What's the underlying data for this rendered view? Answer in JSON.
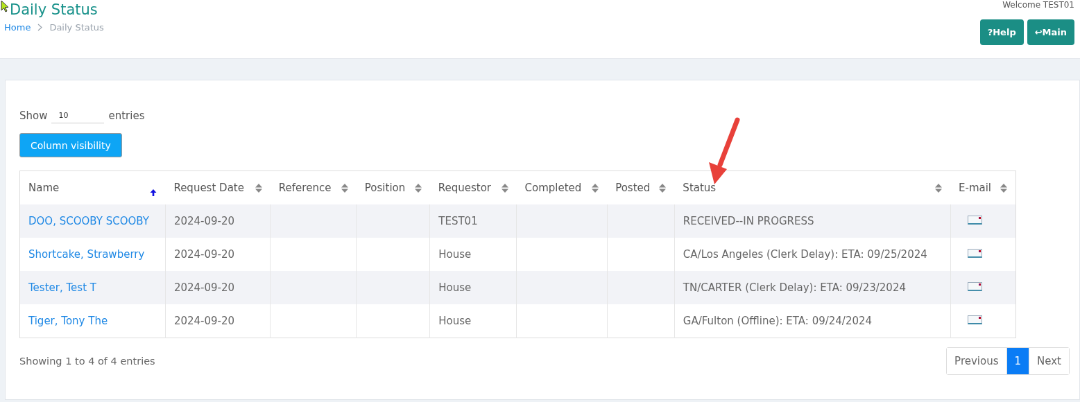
{
  "page": {
    "title": "Daily Status",
    "welcome": "Welcome TEST01"
  },
  "breadcrumb": [
    {
      "label": "Home",
      "kind": "link"
    },
    {
      "label": "Daily Status",
      "kind": "current"
    }
  ],
  "header_buttons": [
    {
      "label": "Help",
      "icon": "?"
    },
    {
      "label": "Main",
      "icon": "↩"
    }
  ],
  "length_control": {
    "before": "Show",
    "value": "10",
    "after": "entries"
  },
  "column_visibility_button": "Column visibility",
  "table": {
    "columns": [
      {
        "label": "Name",
        "sorted": true
      },
      {
        "label": "Request Date",
        "sorted": false
      },
      {
        "label": "Reference",
        "sorted": false
      },
      {
        "label": "Position",
        "sorted": false
      },
      {
        "label": "Requestor",
        "sorted": false
      },
      {
        "label": "Completed",
        "sorted": false
      },
      {
        "label": "Posted",
        "sorted": false
      },
      {
        "label": "Status",
        "sorted": false
      },
      {
        "label": "E-mail",
        "sorted": false
      }
    ],
    "rows": [
      {
        "name": "DOO, SCOOBY SCOOBY",
        "request_date": "2024-09-20",
        "requestor": "TEST01",
        "status": "RECEIVED--IN PROGRESS"
      },
      {
        "name": "Shortcake, Strawberry",
        "request_date": "2024-09-20",
        "requestor": "House",
        "status": "CA/Los Angeles (Clerk Delay): ETA: 09/25/2024"
      },
      {
        "name": "Tester, Test T",
        "request_date": "2024-09-20",
        "requestor": "House",
        "status": "TN/CARTER (Clerk Delay): ETA: 09/23/2024"
      },
      {
        "name": "Tiger, Tony The",
        "request_date": "2024-09-20",
        "requestor": "House",
        "status": "GA/Fulton (Offline): ETA: 09/24/2024"
      }
    ]
  },
  "info": "Showing 1 to 4 of 4 entries",
  "pagination": [
    {
      "label": "Previous",
      "selected": false
    },
    {
      "label": "1",
      "selected": true
    },
    {
      "label": "Next",
      "selected": false
    }
  ]
}
